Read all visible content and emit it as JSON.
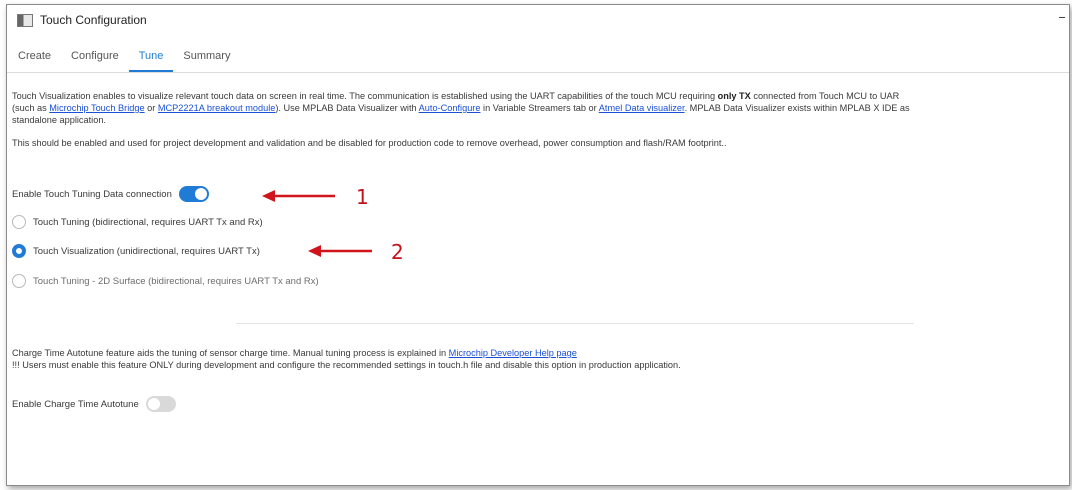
{
  "window": {
    "title": "Touch Configuration"
  },
  "tabs": [
    {
      "label": "Create",
      "active": false
    },
    {
      "label": "Configure",
      "active": false
    },
    {
      "label": "Tune",
      "active": true
    },
    {
      "label": "Summary",
      "active": false
    }
  ],
  "visualization": {
    "line1_a": "Touch Visualization enables to visualize relevant touch data on screen in real time. The communication is established using the UART capabilities of the touch MCU requiring ",
    "line1_bold": "only TX",
    "line1_b": " connected from Touch MCU to UAR",
    "line2_a": "(such as ",
    "link_bridge": "Microchip Touch Bridge",
    "line2_b": " or ",
    "link_mcp": "MCP2221A breakout module",
    "line2_c": "). Use MPLAB Data Visualizer with ",
    "link_autoconfig": "Auto-Configure",
    "line2_d": " in Variable Streamers tab or ",
    "link_atmel": "Atmel Data visualizer",
    "line2_e": ". MPLAB Data Visualizer exists within MPLAB X IDE as",
    "line3": "standalone application.",
    "line4": "This should be enabled and used for project development and validation and be disabled for production code to remove overhead, power consumption and flash/RAM footprint.."
  },
  "tuning_toggle": {
    "label": "Enable Touch Tuning Data connection",
    "on": true
  },
  "radios": [
    {
      "label": "Touch Tuning (bidirectional, requires UART Tx and Rx)",
      "checked": false
    },
    {
      "label": "Touch Visualization (unidirectional, requires UART Tx)",
      "checked": true
    },
    {
      "label": "Touch Tuning - 2D Surface (bidirectional, requires UART Tx and Rx)",
      "checked": false
    }
  ],
  "charge_time": {
    "line1": "Charge Time Autotune feature aids the tuning of sensor charge time. Manual tuning process is explained in ",
    "link_help": "Microchip Developer Help page",
    "line2": "!!! Users must enable this feature ONLY during development and configure the recommended settings in touch.h file and disable this option in production application."
  },
  "autotune_toggle": {
    "label": "Enable Charge Time Autotune",
    "on": false
  },
  "annotations": [
    {
      "label": "1",
      "color": "#c0131b"
    },
    {
      "label": "2",
      "color": "#c0131b"
    }
  ]
}
